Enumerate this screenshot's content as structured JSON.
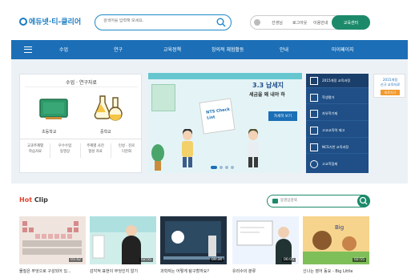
{
  "header": {
    "logo_text": "에듀넷·티-클리어",
    "search_placeholder": "검색어를 입력해 보세요.",
    "user_links": [
      "선생님",
      "로그아웃",
      "이용안내"
    ],
    "edu_center": "교육센터"
  },
  "nav": {
    "items": [
      "수업",
      "연구",
      "교육정책",
      "창의적 체험활동",
      "안내",
      "마이페이지"
    ]
  },
  "materials": {
    "title": "수업 · 연구자료",
    "labels": [
      "초등학교",
      "중학교"
    ],
    "sub_links": [
      [
        "교과주제별",
        "학습자료"
      ],
      [
        "우수수업",
        "동영상"
      ],
      [
        "주제별 사전",
        "형성 자료"
      ],
      [
        "인성 · 진로",
        "다문화"
      ]
    ]
  },
  "banner": {
    "headline": "3.3 납세지",
    "subline": "세금을 왜 내야 하",
    "card_label": "NTS Check List",
    "more_button": "자세히 보기",
    "slide_count": 4,
    "active_slide": 1
  },
  "quick_menu": {
    "items": [
      "2015개정 교육과정",
      "학생평가",
      "자유학기제",
      "고교교육력 제고",
      "NCS기반 교육과정",
      "고교학점제"
    ]
  },
  "side_ad": {
    "line1": "2015개정",
    "line2": "신규 교육자료",
    "button": "바로가기"
  },
  "hot_clip": {
    "title_hot": "Hot",
    "title_clip": "Clip",
    "search_placeholder": "동영상검색",
    "videos": [
      {
        "caption": "물질은 무엇으로 구성되어 있...",
        "duration": "01:42"
      },
      {
        "caption": "감각적 표현이 무엇인지 알기",
        "duration": "02:55"
      },
      {
        "caption": "과학자는 어떻게 탐구할까요?",
        "duration": "09:34"
      },
      {
        "caption": "유리수의 분류",
        "duration": "06:05"
      },
      {
        "caption": "신나는 영어 동요 - Big Little",
        "duration": "02:55"
      }
    ]
  },
  "colors": {
    "nav": "#1c6fb6",
    "green": "#1c8a6a",
    "hot": "#e2432a",
    "quick_menu": "#1f4f86"
  }
}
